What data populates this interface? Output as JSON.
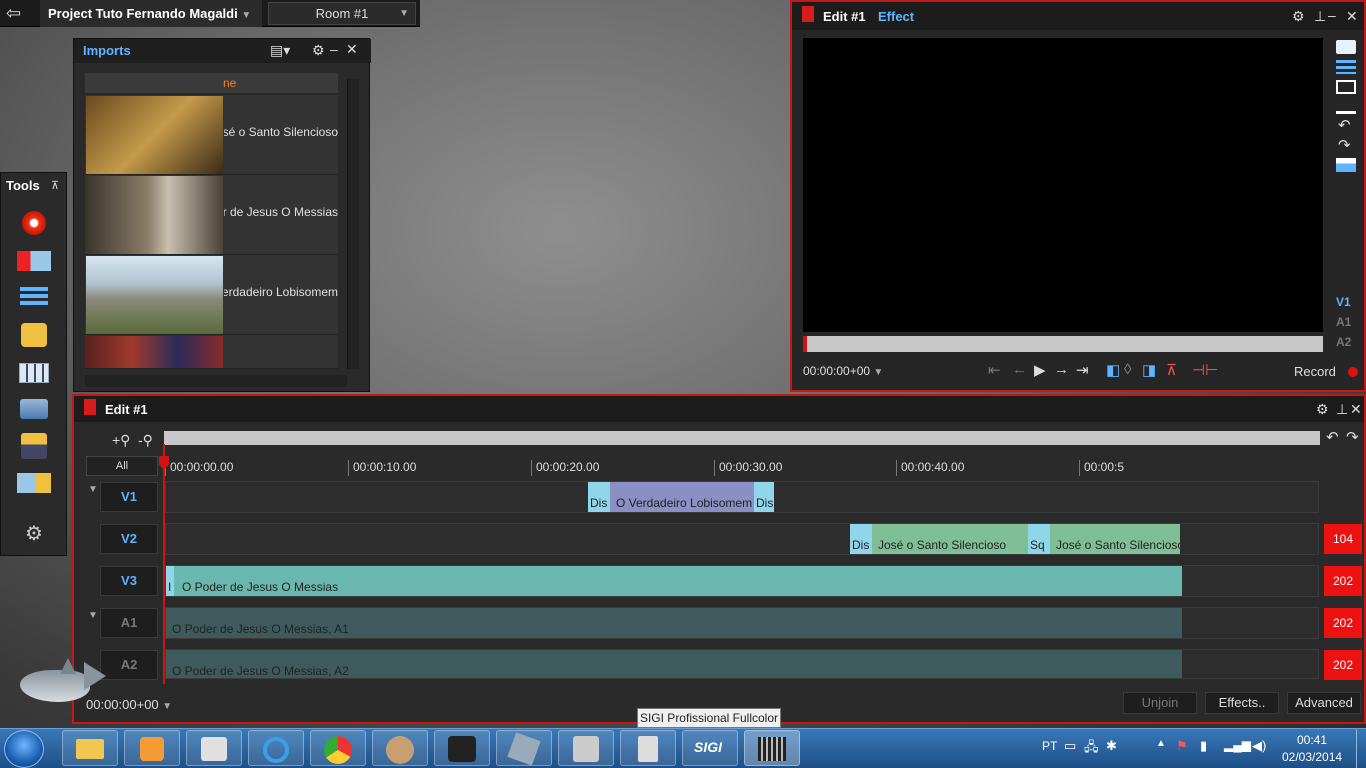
{
  "topbar": {
    "project": "Project Tuto Fernando Magaldi",
    "room": "Room #1"
  },
  "imports": {
    "title": "Imports",
    "column": "ne",
    "items": [
      {
        "label": "José o Santo Silencioso"
      },
      {
        "label": "O Poder de Jesus   O Messias"
      },
      {
        "label": "O Verdadeiro Lobisomem"
      },
      {
        "label": ""
      }
    ]
  },
  "tools": {
    "title": "Tools"
  },
  "viewer": {
    "title": "Edit #1",
    "tab": "Effect",
    "timecode": "00:00:00+00",
    "record": "Record",
    "tracks": [
      "V1",
      "A1",
      "A2"
    ]
  },
  "timeline": {
    "title": "Edit #1",
    "all": "All",
    "ticks": [
      "00:00:00.00",
      "00:00:10.00",
      "00:00:20.00",
      "00:00:30.00",
      "00:00:40.00",
      "00:00:5"
    ],
    "tracks": [
      {
        "name": "V1",
        "badge": ""
      },
      {
        "name": "V2",
        "badge": "104"
      },
      {
        "name": "V3",
        "badge": "202"
      },
      {
        "name": "A1",
        "badge": "202"
      },
      {
        "name": "A2",
        "badge": "202"
      }
    ],
    "clips": {
      "v1_t1": "Dis",
      "v1_main": "O Verdadeiro Lobisomem",
      "v1_t2": "Dis",
      "v2_t1": "Dis",
      "v2_c1": "José o Santo Silencioso",
      "v2_t2": "Sq",
      "v2_c2": "José o Santo Silencioso",
      "v3_t": "I",
      "v3_c": "O Poder de Jesus   O Messias",
      "a1_c": "O Poder de Jesus   O Messias, A1",
      "a2_c": "O Poder de Jesus   O Messias, A2"
    },
    "timecode": "00:00:00+00",
    "unjoin": "Unjoin",
    "effects": "Effects..",
    "advanced": "Advanced"
  },
  "taskbar": {
    "tooltip": "SIGI Profissional Fullcolor",
    "lang": "PT",
    "time": "00:41",
    "date": "02/03/2014"
  },
  "colors": {
    "accent_blue": "#5fb3ff",
    "accent_red": "#c21818",
    "clip_v1": "#8a8fc4",
    "clip_v2": "#7fbf98",
    "clip_v3": "#6ab7b0",
    "clip_audio": "#3f5a5c"
  }
}
